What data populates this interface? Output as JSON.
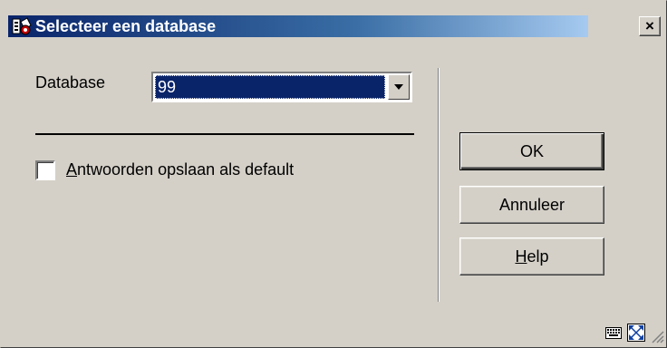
{
  "window": {
    "title": "Selecteer een database",
    "close_label": "×"
  },
  "form": {
    "database_label": "Database",
    "database_selected": "99",
    "checkbox_label_mnemonic": "A",
    "checkbox_label_rest": "ntwoorden opslaan als default",
    "checkbox_checked": false
  },
  "buttons": {
    "ok_label": "OK",
    "cancel_label": "Annuleer",
    "help_mnemonic": "H",
    "help_rest": "elp"
  },
  "icons": {
    "app": "library-book-icon",
    "status1": "keyboard-icon",
    "status2": "fullscreen-icon",
    "grip": "resize-grip-icon"
  },
  "colors": {
    "face": "#d4d0c8",
    "titlebar": "#0a246a",
    "selection": "#0a246a"
  }
}
